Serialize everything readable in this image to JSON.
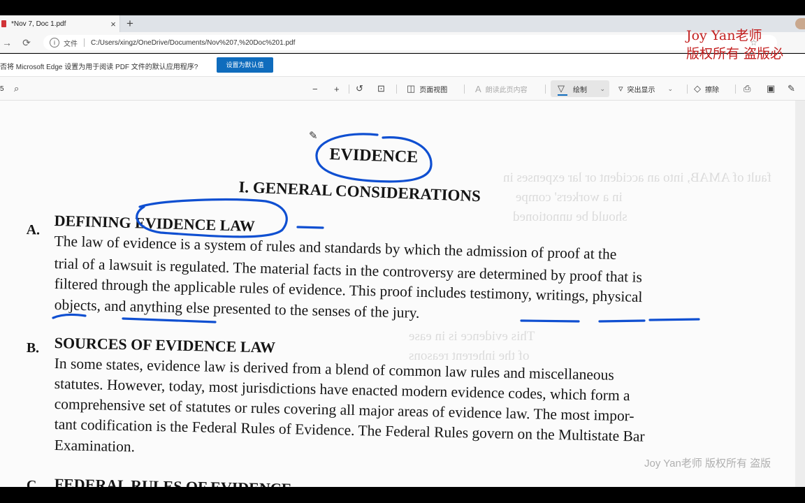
{
  "browser": {
    "tab_title": "*Nov 7, Doc 1.pdf",
    "tab_close": "×",
    "new_tab": "+",
    "url_scheme": "文件",
    "url": "C:/Users/xingz/OneDrive/Documents/Nov%207,%20Doc%201.pdf",
    "infobar_message": "否将 Microsoft Edge 设置为用于阅读 PDF 文件的默认应用程序?",
    "infobar_button": "设置为默认值"
  },
  "pdf_toolbar": {
    "page_number": "5",
    "page_view": "页面视图",
    "read_aloud": "朗读此页内容",
    "draw": "绘制",
    "highlight": "突出显示",
    "erase": "擦除"
  },
  "watermark": {
    "line1": "Joy Yan老师",
    "line2": "版权所有 盗版必",
    "bottom": "Joy Yan老师 版权所有 盗版"
  },
  "document": {
    "title": "EVIDENCE",
    "section_heading": "I.  GENERAL CONSIDERATIONS",
    "sections": [
      {
        "letter": "A.",
        "heading": "DEFINING EVIDENCE LAW",
        "lines": [
          "The law of evidence is a system of rules and standards by which the admission of proof at the",
          "trial of a lawsuit is regulated. The material facts in the controversy are determined by proof that is",
          "filtered through the applicable rules of evidence. This proof includes testimony, writings, physical",
          "objects, and anything else presented to the senses of the jury."
        ]
      },
      {
        "letter": "B.",
        "heading": "SOURCES OF EVIDENCE LAW",
        "lines": [
          "In some states, evidence law is derived from a blend of common law rules and miscellaneous",
          "statutes. However, today, most jurisdictions have enacted modern evidence codes, which form a",
          "comprehensive set of statutes or rules covering all major areas of evidence law. The most impor-",
          "tant codification is the Federal Rules of Evidence. The Federal Rules govern on the Multistate Bar",
          "Examination."
        ]
      },
      {
        "letter": "C.",
        "heading": "FEDERAL RULES OF EVIDENCE"
      }
    ]
  },
  "bleed_through": [
    "fault of AMAB, into an accident or lar expenses in",
    "in a workers' compe",
    "should be unnotioned",
    "This evidence is in ease",
    "of the inherent reasons"
  ],
  "colors": {
    "ink": "#0f4fd1",
    "accent": "#0f6cbd",
    "watermark": "#c31f1f"
  }
}
